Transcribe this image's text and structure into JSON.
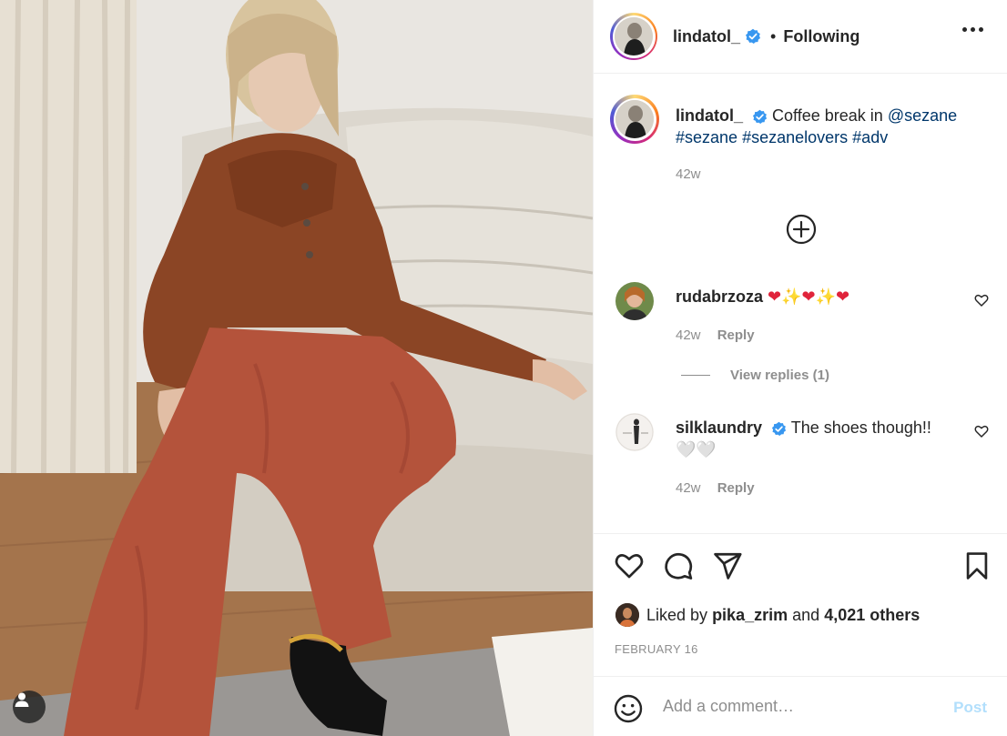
{
  "header": {
    "username": "lindatol_",
    "separator": "•",
    "follow_status": "Following"
  },
  "caption": {
    "username": "lindatol_",
    "text": "Coffee break in",
    "mention": "@sezane",
    "hashtags": [
      "#sezane",
      "#sezanelovers",
      "#adv"
    ],
    "time": "42w"
  },
  "comments": [
    {
      "username": "rudabrzoza",
      "text": "❤✨❤✨❤",
      "time": "42w",
      "reply_label": "Reply",
      "view_replies": "View replies (1)"
    },
    {
      "username": "silklaundry",
      "text": "The shoes though!!",
      "text2": "🤍🤍",
      "time": "42w",
      "reply_label": "Reply"
    }
  ],
  "likes": {
    "prefix": "Liked by",
    "user": "pika_zrim",
    "conjunction": "and",
    "count": "4,021 others"
  },
  "date": "FEBRUARY 16",
  "add_comment": {
    "placeholder": "Add a comment…",
    "post_label": "Post"
  },
  "colors": {
    "accent_link": "#00376b",
    "verified_blue": "#3897f0",
    "post_disabled": "#b2dffc",
    "muted": "#8e8e8e"
  },
  "icons": [
    "verified-badge-icon",
    "more-options-icon",
    "load-more-plus-icon",
    "heart-icon",
    "comment-icon",
    "share-icon",
    "save-bookmark-icon",
    "emoji-icon",
    "user-tag-icon"
  ]
}
